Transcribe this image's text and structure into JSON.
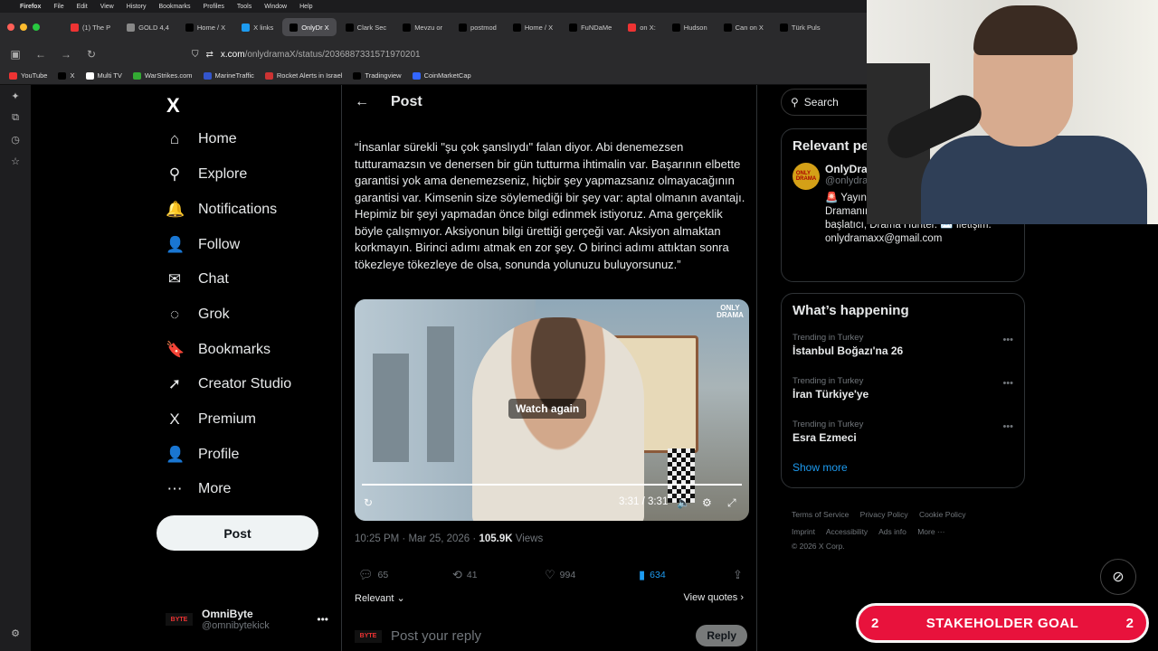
{
  "browser": {
    "menu": [
      "Firefox",
      "File",
      "Edit",
      "View",
      "History",
      "Bookmarks",
      "Profiles",
      "Tools",
      "Window",
      "Help"
    ],
    "tabs": [
      {
        "label": "(1) The P",
        "color": "#e33"
      },
      {
        "label": "GOLD 4,4",
        "color": "#888"
      },
      {
        "label": "Home / X",
        "color": "#000"
      },
      {
        "label": "X links",
        "color": "#1d9bf0"
      },
      {
        "label": "OnlyDr X",
        "color": "#000"
      },
      {
        "label": "Clark Sec",
        "color": "#000"
      },
      {
        "label": "Mevzu or",
        "color": "#000"
      },
      {
        "label": "postmod",
        "color": "#000"
      },
      {
        "label": "Home / X",
        "color": "#000"
      },
      {
        "label": "FuNDaMe",
        "color": "#000"
      },
      {
        "label": "on X:",
        "color": "#e33"
      },
      {
        "label": "Hudson",
        "color": "#000"
      },
      {
        "label": "Can on X",
        "color": "#000"
      },
      {
        "label": "Türk Puls",
        "color": "#000"
      }
    ],
    "url_host": "x.com",
    "url_path": "/onlydramaX/status/2036887331571970201",
    "bookmarks": [
      {
        "label": "YouTube",
        "color": "#e33"
      },
      {
        "label": "X",
        "color": "#000"
      },
      {
        "label": "Multi TV",
        "color": "#fff"
      },
      {
        "label": "WarStrikes.com",
        "color": "#3a3"
      },
      {
        "label": "MarineTraffic",
        "color": "#35c"
      },
      {
        "label": "Rocket Alerts in Israel",
        "color": "#c33"
      },
      {
        "label": "Tradingview",
        "color": "#000"
      },
      {
        "label": "CoinMarketCap",
        "color": "#36f"
      }
    ]
  },
  "nav": {
    "logo": "X",
    "items": [
      {
        "icon": "⌂",
        "label": "Home"
      },
      {
        "icon": "⚲",
        "label": "Explore"
      },
      {
        "icon": "🔔",
        "label": "Notifications"
      },
      {
        "icon": "👤",
        "label": "Follow"
      },
      {
        "icon": "✉",
        "label": "Chat"
      },
      {
        "icon": "◌",
        "label": "Grok"
      },
      {
        "icon": "🔖",
        "label": "Bookmarks"
      },
      {
        "icon": "➚",
        "label": "Creator Studio"
      },
      {
        "icon": "X",
        "label": "Premium"
      },
      {
        "icon": "👤",
        "label": "Profile"
      },
      {
        "icon": "⋯",
        "label": "More"
      }
    ],
    "post_button": "Post",
    "account_name": "OmniByte",
    "account_handle": "@omnibytekick",
    "account_badge": "BYTE"
  },
  "post": {
    "header": "Post",
    "text": "“İnsanlar sürekli \"şu çok şanslıydı\" falan diyor. Abi denemezsen tutturamazsın ve denersen bir gün tutturma ihtimalin var. Başarının elbette garantisi yok ama denemezseniz, hiçbir şey yapmazsanız olmayacağının garantisi var. Kimsenin size söylemediği bir şey var: aptal olmanın avantajı. Hepimiz bir şeyi yapmadan önce bilgi edinmek istiyoruz. Ama gerçeklik böyle çalışmıyor. Aksiyonun bilgi ürettiği gerçeği var. Aksiyon almaktan korkmayın. Birinci adımı atmak en zor şey. O birinci adımı attıktan sonra tökezleye tökezleye de olsa, sonunda yolunuzu buluyorsunuz.”",
    "video_logo": "ONLY DRAMA",
    "watch_again": "Watch again",
    "video_time": "3:31 / 3:31",
    "timestamp": "10:25 PM · Mar 25, 2026 · ",
    "views_count": "105.9K",
    "views_label": " Views",
    "replies": "65",
    "reposts": "41",
    "likes": "994",
    "bookmarks": "634",
    "relevant": "Relevant",
    "view_quotes": "View quotes",
    "reply_placeholder": "Post your reply",
    "reply_button": "Reply"
  },
  "sidebar": {
    "search_placeholder": "Search",
    "relevant_title": "Relevant people",
    "relevant_name": "OnlyDrama",
    "relevant_handle": "@onlydramax",
    "relevant_bio": "🚨 Yayın Kavga dozunuz karşılanır. Dramanın en büyük adresi, tartışma başlatıcı, Drama Hunter. ✉️ İletişim: onlydramaxx@gmail.com",
    "happening_title": "What’s happening",
    "trends": [
      {
        "label": "Trending in Turkey",
        "title": "İstanbul Boğazı'na 26"
      },
      {
        "label": "Trending in Turkey",
        "title": "İran Türkiye'ye"
      },
      {
        "label": "Trending in Turkey",
        "title": "Esra Ezmeci"
      }
    ],
    "show_more": "Show more",
    "footer_links": [
      "Terms of Service",
      "Privacy Policy",
      "Cookie Policy",
      "Imprint",
      "Accessibility",
      "Ads info",
      "More ···"
    ],
    "copyright": "© 2026 X Corp."
  },
  "overlay": {
    "goal_left": "2",
    "goal_title": "STAKEHOLDER GOAL",
    "goal_right": "2"
  }
}
